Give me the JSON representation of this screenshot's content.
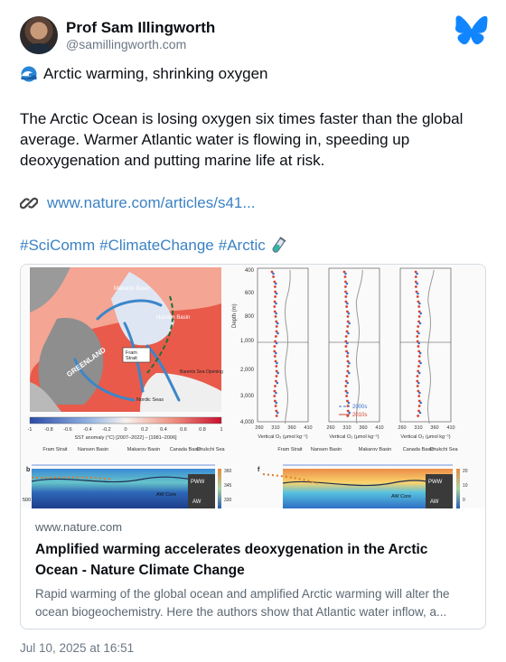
{
  "author": {
    "name": "Prof Sam Illingworth",
    "handle": "@samillingworth.com"
  },
  "app": {
    "logo_icon": "butterfly-icon",
    "brand_color": "#1185fe"
  },
  "post": {
    "headline_icon": "wave-emoji-icon",
    "headline": "Arctic warming, shrinking oxygen",
    "body": "The Arctic Ocean is losing oxygen six times faster than the global average. Warmer Atlantic water is flowing in, speeding up deoxygenation and putting marine life at risk.",
    "link_icon": "paperclip-icon",
    "link_text": "www.nature.com/articles/s41...",
    "hashtags": [
      "#SciComm",
      "#ClimateChange",
      "#Arctic"
    ],
    "hashtag_icon": "test-tube-icon",
    "timestamp": "Jul 10, 2025 at 16:51"
  },
  "link_card": {
    "domain": "www.nature.com",
    "title": "Amplified warming accelerates deoxygenation in the Arctic Ocean - Nature Climate Change",
    "description": "Rapid warming of the global ocean and amplified Arctic warming will alter the ocean biogeochemistry. Here the authors show that Atlantic water inflow, a...",
    "figure": {
      "map_labels": [
        "Barents Sea Opening",
        "Makarov Basin",
        "GREENLAND",
        "Fram Strait",
        "Nordic Seas",
        "Nansen Basin"
      ],
      "colorbar_ticks": [
        "-1",
        "-0.8",
        "-0.6",
        "-0.4",
        "-0.2",
        "0",
        "0.2",
        "0.4",
        "0.6",
        "0.8",
        "1"
      ],
      "colorbar_label": "SST anomaly (°C) [2007–2022] – [1981–2006]",
      "depth_label": "Depth (m)",
      "depth_ticks": [
        "400",
        "600",
        "800",
        "1,000",
        "2,000",
        "3,000",
        "4,000"
      ],
      "x_ticks": [
        "260",
        "310",
        "360",
        "410"
      ],
      "x_label": "Vertical O₂ (μmol kg⁻¹)",
      "legend": [
        "2000s",
        "2010s"
      ],
      "section_b_stations": [
        "Fram Strait",
        "Nansen Basin",
        "Makarov Basin",
        "Canada Basin",
        "Chukchi Sea"
      ],
      "section_f_stations": [
        "Fram Strait",
        "Nansen Basin",
        "Makarov Basin",
        "Canada Basin",
        "Chukchi Sea"
      ],
      "section_panel_labels": [
        "b",
        "f"
      ],
      "section_water_labels": [
        "PWW",
        "AW",
        "AW Core"
      ],
      "section_depth_tick": "500",
      "section_colorbar_ticks": [
        "360",
        "345",
        "330"
      ],
      "section_f_colorbar_ticks": [
        "20",
        "10",
        "0"
      ]
    }
  }
}
